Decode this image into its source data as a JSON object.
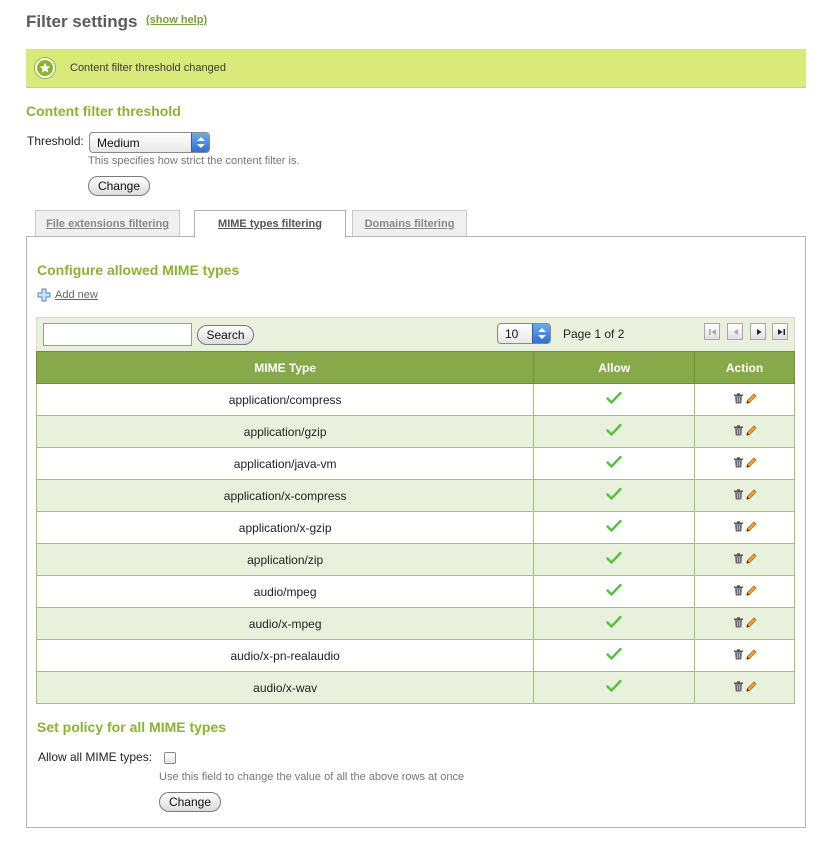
{
  "header": {
    "title": "Filter settings",
    "help_link": "(show help)"
  },
  "notice": {
    "text": "Content filter threshold changed",
    "color": "#d9ea7a"
  },
  "threshold": {
    "heading": "Content filter threshold",
    "label": "Threshold:",
    "selected": "Medium",
    "hint": "This specifies how strict the content filter is.",
    "button": "Change"
  },
  "tabs": [
    {
      "label": "File extensions filtering",
      "active": false
    },
    {
      "label": "MIME types filtering",
      "active": true
    },
    {
      "label": "Domains filtering",
      "active": false
    }
  ],
  "mime": {
    "heading": "Configure allowed MIME types",
    "add_new": "Add new",
    "search": {
      "placeholder": "",
      "button": "Search"
    },
    "per_page": "10",
    "page_info": "Page 1 of 2",
    "columns": [
      "MIME Type",
      "Allow",
      "Action"
    ],
    "rows": [
      {
        "mime": "application/compress",
        "allow": true
      },
      {
        "mime": "application/gzip",
        "allow": true
      },
      {
        "mime": "application/java-vm",
        "allow": true
      },
      {
        "mime": "application/x-compress",
        "allow": true
      },
      {
        "mime": "application/x-gzip",
        "allow": true
      },
      {
        "mime": "application/zip",
        "allow": true
      },
      {
        "mime": "audio/mpeg",
        "allow": true
      },
      {
        "mime": "audio/x-mpeg",
        "allow": true
      },
      {
        "mime": "audio/x-pn-realaudio",
        "allow": true
      },
      {
        "mime": "audio/x-wav",
        "allow": true
      }
    ]
  },
  "policy": {
    "heading": "Set policy for all MIME types",
    "label": "Allow all MIME types:",
    "checked": false,
    "hint": "Use this field to change the value of all the above rows at once",
    "button": "Change"
  },
  "colors": {
    "accent": "#8ab332",
    "header_bg": "#87a94a",
    "row_alt": "#e9f0dc"
  }
}
